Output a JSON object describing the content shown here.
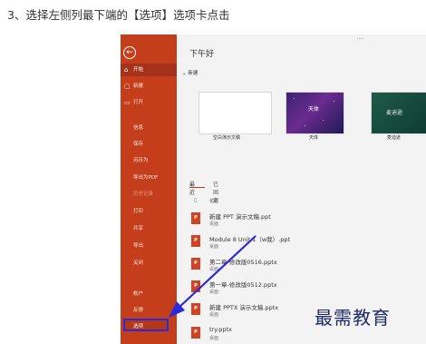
{
  "caption": "3、选择左侧列最下端的【选项】选项卡点击",
  "sidebar": {
    "back_icon": "←",
    "nav": [
      {
        "icon": "⌂",
        "label": "开始"
      },
      {
        "icon": "▢",
        "label": "新建"
      },
      {
        "icon": "▭",
        "label": "打开"
      }
    ],
    "sub": [
      "信息",
      "保存",
      "另存为",
      "导出为PDF",
      "历史记录",
      "打印",
      "共享",
      "导出",
      "关闭",
      "帐户",
      "反馈"
    ],
    "options_label": "选项"
  },
  "main": {
    "greeting": "下午好",
    "new_section": "新建",
    "templates": [
      {
        "label": "空白演示文稿",
        "text": ""
      },
      {
        "label": "天体",
        "text": "天体"
      },
      {
        "label": "麦迪逊",
        "text": "麦迪逊"
      }
    ],
    "tabs": {
      "recent": "最近",
      "pinned": "已固定"
    },
    "column_header": "名称",
    "files": [
      {
        "name": "新建 PPT 演示文稿.ppt",
        "location": "桌面"
      },
      {
        "name": "Module 8 Unit 1（w我）.ppt",
        "location": "桌面"
      },
      {
        "name": "第二章-修改版0516.pptx",
        "location": "桌面"
      },
      {
        "name": "第一章-修改版0512.pptx",
        "location": "桌面"
      },
      {
        "name": "新建 PPTX 演示文稿.pptx",
        "location": "桌面"
      },
      {
        "name": "try.pptx",
        "location": "桌面"
      }
    ],
    "file_icon": "P"
  },
  "watermark": "最需教育",
  "colors": {
    "sidebar": "#c43e1c",
    "highlight": "#2a2adb",
    "arrow": "#2a2adb"
  }
}
